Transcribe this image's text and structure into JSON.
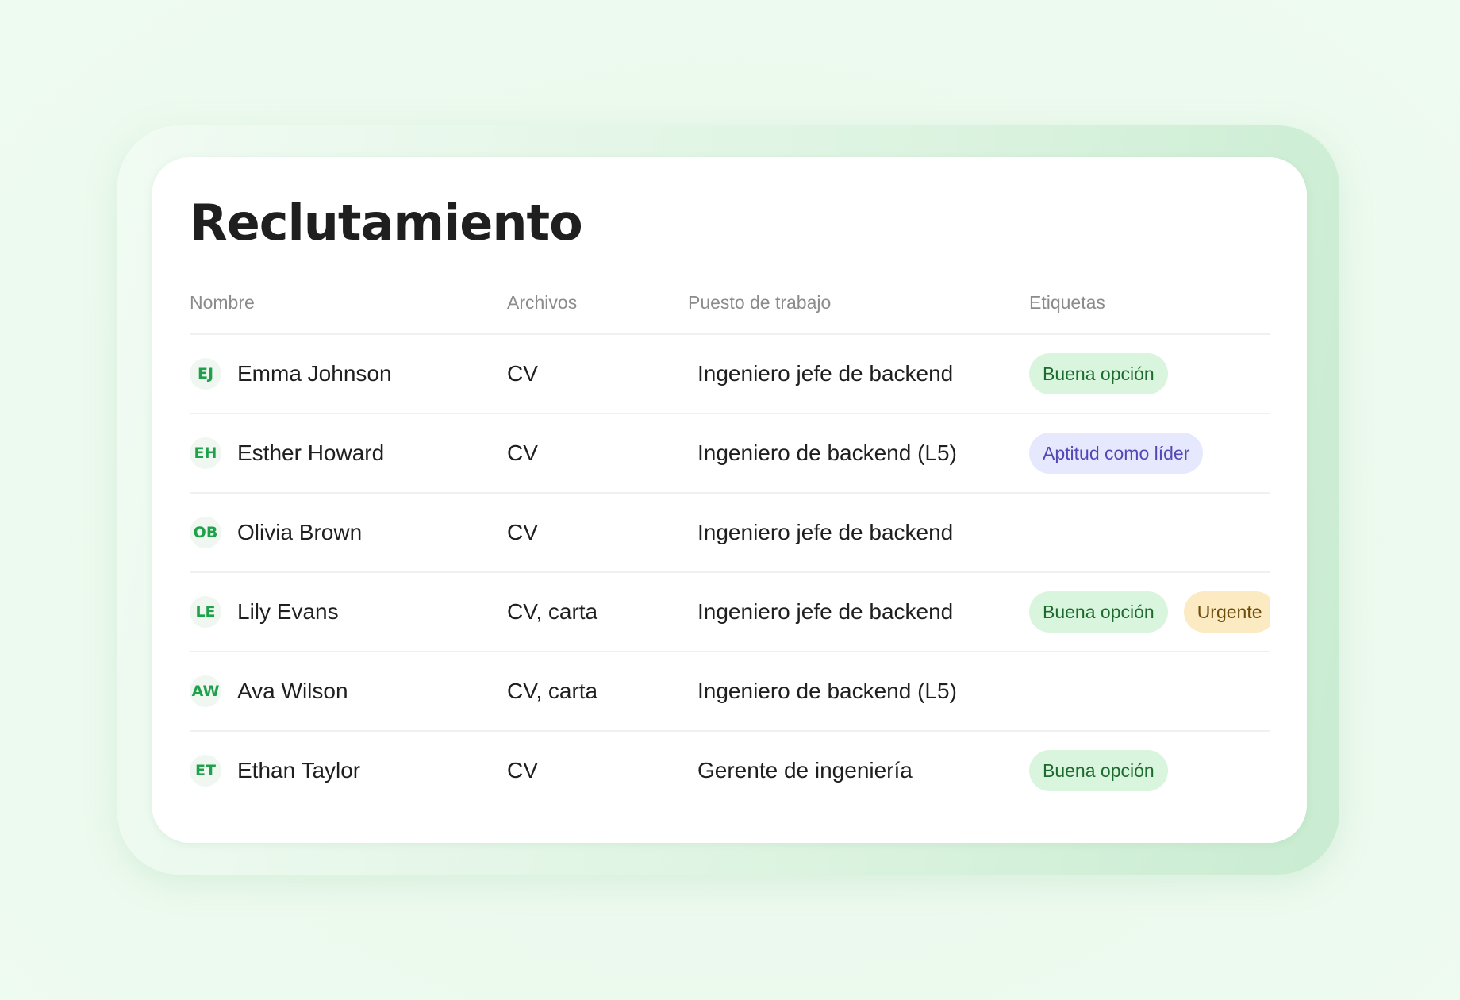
{
  "title": "Reclutamiento",
  "columns": {
    "name": "Nombre",
    "files": "Archivos",
    "job": "Puesto de trabajo",
    "tags": "Etiquetas"
  },
  "rows": [
    {
      "initials": "EJ",
      "name": "Emma Johnson",
      "files": "CV",
      "job": "Ingeniero jefe de backend",
      "tags": [
        {
          "label": "Buena opción",
          "color": "#d9f5dd"
        }
      ]
    },
    {
      "initials": "EH",
      "name": "Esther Howard",
      "files": "CV",
      "job": "Ingeniero de backend (L5)",
      "tags": [
        {
          "label": "Aptitud como líder",
          "color": "#e6e8fd"
        }
      ]
    },
    {
      "initials": "OB",
      "name": "Olivia Brown",
      "files": "CV",
      "job": "Ingeniero jefe de backend",
      "tags": []
    },
    {
      "initials": "LE",
      "name": "Lily Evans",
      "files": "CV, carta",
      "job": "Ingeniero jefe de backend",
      "tags": [
        {
          "label": "Buena opción",
          "color": "#d9f5dd"
        },
        {
          "label": "Urgente",
          "color": "#fbeac2"
        }
      ]
    },
    {
      "initials": "AW",
      "name": "Ava Wilson",
      "files": "CV, carta",
      "job": "Ingeniero de backend (L5)",
      "tags": []
    },
    {
      "initials": "ET",
      "name": "Ethan Taylor",
      "files": "CV",
      "job": "Gerente de ingeniería",
      "tags": [
        {
          "label": "Buena opción",
          "color": "#d9f5dd"
        }
      ]
    }
  ]
}
